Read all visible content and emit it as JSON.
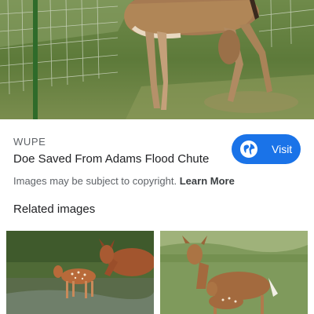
{
  "result": {
    "source": "WUPE",
    "title": "Doe Saved From Adams Flood Chute",
    "visit_label": "Visit",
    "copyright_text": "Images may be subject to copyright.",
    "learn_more": "Learn More"
  },
  "related": {
    "heading": "Related images"
  },
  "icons": {
    "visit": "globe-icon"
  },
  "colors": {
    "accent": "#1a73e8",
    "secondary_text": "#5f6368"
  }
}
